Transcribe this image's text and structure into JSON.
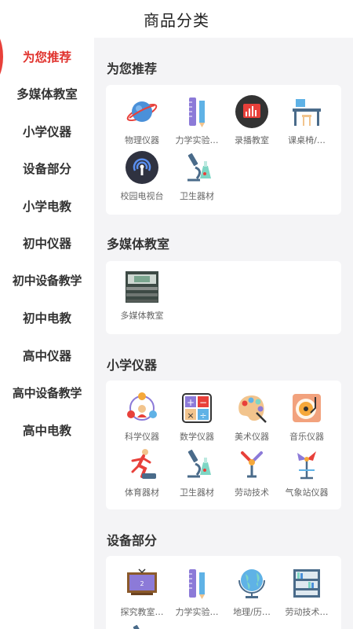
{
  "header": {
    "title": "商品分类"
  },
  "sidebar": {
    "items": [
      {
        "label": "为您推荐"
      },
      {
        "label": "多媒体教室"
      },
      {
        "label": "小学仪器"
      },
      {
        "label": "设备部分"
      },
      {
        "label": "小学电教"
      },
      {
        "label": "初中仪器"
      },
      {
        "label": "初中设备教学"
      },
      {
        "label": "初中电教"
      },
      {
        "label": "高中仪器"
      },
      {
        "label": "高中设备教学"
      },
      {
        "label": "高中电教"
      }
    ]
  },
  "sections": [
    {
      "title": "为您推荐",
      "items": [
        {
          "label": "物理仪器",
          "icon": "planet-icon"
        },
        {
          "label": "力学实验…",
          "icon": "ruler-pencil-icon"
        },
        {
          "label": "录播教室",
          "icon": "recording-chart-icon"
        },
        {
          "label": "课桌椅/…",
          "icon": "desk-chair-icon"
        },
        {
          "label": "校园电视台",
          "icon": "broadcast-icon"
        },
        {
          "label": "卫生器材",
          "icon": "microscope-icon"
        }
      ]
    },
    {
      "title": "多媒体教室",
      "items": [
        {
          "label": "多媒体教室",
          "icon": "classroom-photo-icon"
        }
      ]
    },
    {
      "title": "小学仪器",
      "items": [
        {
          "label": "科学仪器",
          "icon": "science-network-icon"
        },
        {
          "label": "数学仪器",
          "icon": "math-symbols-icon"
        },
        {
          "label": "美术仪器",
          "icon": "palette-icon"
        },
        {
          "label": "音乐仪器",
          "icon": "record-player-icon"
        },
        {
          "label": "体育器材",
          "icon": "runner-icon"
        },
        {
          "label": "卫生器材",
          "icon": "microscope-icon"
        },
        {
          "label": "劳动技术",
          "icon": "tools-icon"
        },
        {
          "label": "气象站仪器",
          "icon": "weather-station-icon"
        }
      ]
    },
    {
      "title": "设备部分",
      "items": [
        {
          "label": "探究教室…",
          "icon": "blackboard-icon"
        },
        {
          "label": "力学实验…",
          "icon": "ruler-pencil-icon"
        },
        {
          "label": "地理/历…",
          "icon": "globe-icon"
        },
        {
          "label": "劳动技术…",
          "icon": "bookshelf-icon"
        }
      ]
    }
  ]
}
